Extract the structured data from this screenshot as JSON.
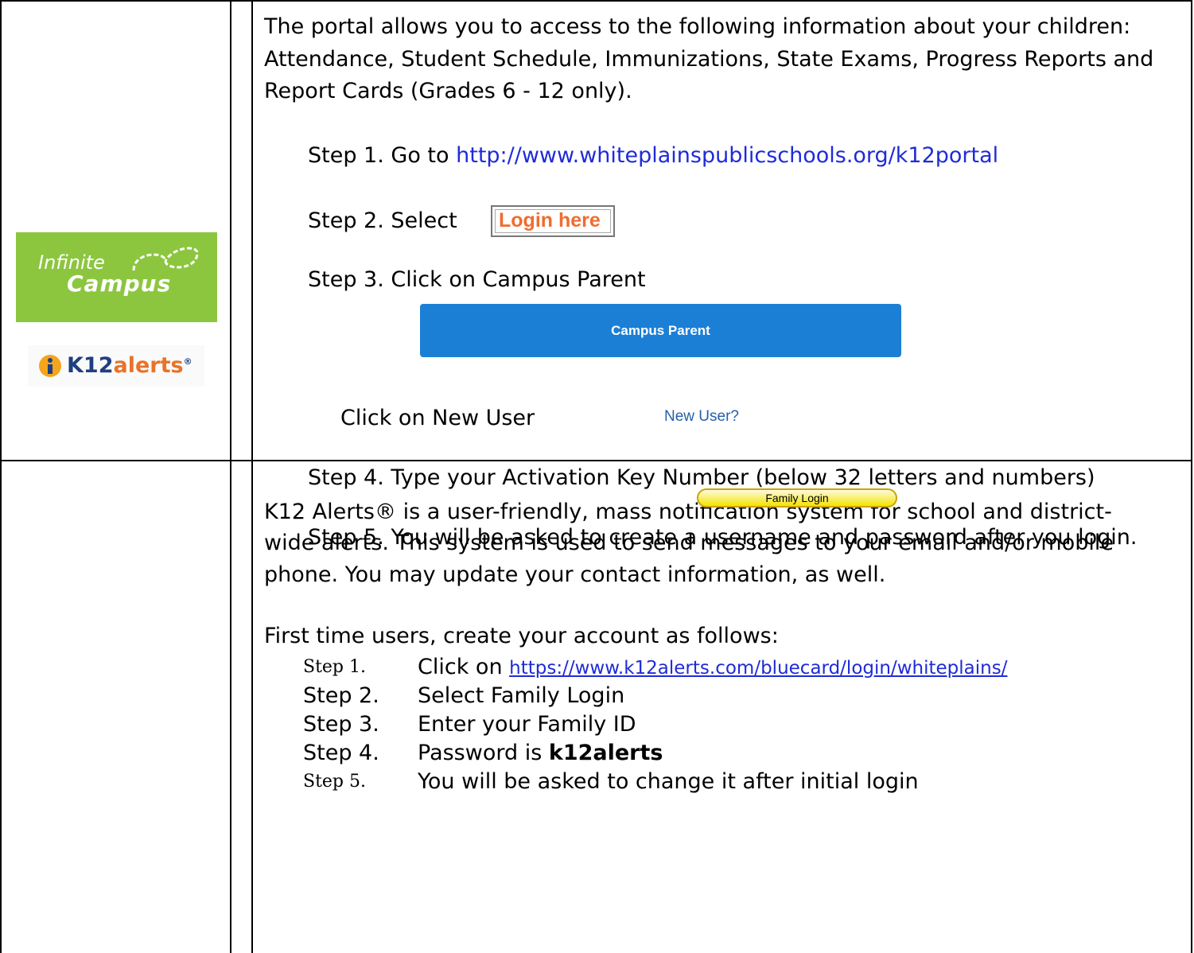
{
  "campus": {
    "logo": {
      "line1": "Infinite",
      "line2": "Campus",
      "icon": "infinity-loop-icon"
    },
    "intro_lines": [
      "The portal allows you to access to the following information about your children:",
      "Attendance, Student Schedule, Immunizations, State Exams, Progress Reports and",
      "Report Cards (Grades 6 - 12 only)."
    ],
    "step1_label": "Step 1.  Go to ",
    "step1_link": "http://www.whiteplainspublicschools.org/k12portal",
    "step2_label": "Step 2.  Select",
    "login_here": "Login here",
    "step3_label": "Step 3.  Click on Campus Parent",
    "campus_parent_button": "Campus Parent",
    "new_user_label": "Click on New User",
    "new_user_link": "New User?",
    "step4_label": "Step 4.  Type your Activation Key Number (below 32 letters and numbers)",
    "step5_label": "Step 5.  You will be asked to create a username and password after you login."
  },
  "k12": {
    "logo": {
      "k12": "K12",
      "alerts": "alerts",
      "icon": "info-person-icon",
      "mark": "®"
    },
    "intro_lines": [
      "K12 Alerts® is a user-friendly, mass notification system for school and district-",
      "wide alerts. This system is used to send messages to your email and/or mobile",
      "phone.  You may update your contact information, as well."
    ],
    "first_time": "First time users, create your account as follows:",
    "steps": [
      {
        "label": "Step 1.",
        "text": "Click on ",
        "link": "https://www.k12alerts.com/bluecard/login/whiteplains/"
      },
      {
        "label": "Step 2.",
        "text": "Select Family Login"
      },
      {
        "label": "Step 3.",
        "text": "Enter your Family ID"
      },
      {
        "label": "Step 4.",
        "text": "Password is ",
        "bold": "k12alerts"
      },
      {
        "label": "Step 5.",
        "text": "You will be asked to change it after initial login"
      }
    ],
    "family_login_button": "Family Login"
  }
}
